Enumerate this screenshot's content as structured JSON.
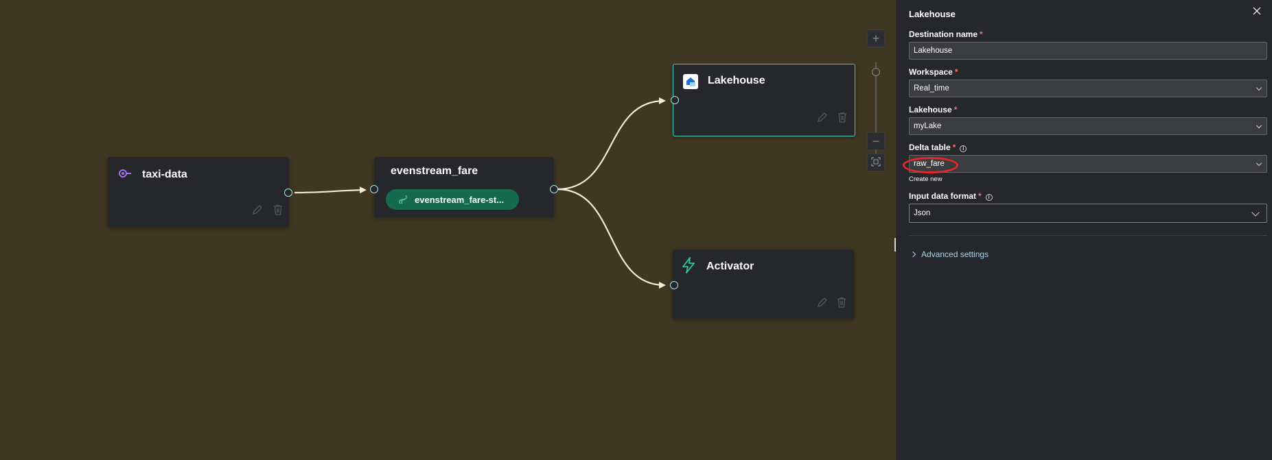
{
  "canvas": {
    "nodes": {
      "source": {
        "title": "taxi-data",
        "icon": "custom-endpoint-icon"
      },
      "stream": {
        "title": "evenstream_fare",
        "chip_label": "evenstream_fare-st..."
      },
      "lakehouse": {
        "title": "Lakehouse",
        "icon": "lakehouse-icon"
      },
      "activator": {
        "title": "Activator",
        "icon": "lightning-icon"
      }
    },
    "zoom_controls": {
      "zoom_in": "+",
      "zoom_out": "−",
      "fit": "fit-to-screen-icon"
    }
  },
  "panel": {
    "title": "Lakehouse",
    "fields": {
      "destination_name": {
        "label": "Destination name",
        "value": "Lakehouse"
      },
      "workspace": {
        "label": "Workspace",
        "value": "Real_time"
      },
      "lakehouse": {
        "label": "Lakehouse",
        "value": "myLake"
      },
      "delta_table": {
        "label": "Delta table",
        "value": "raw_fare",
        "create_new": "Create new"
      },
      "input_format": {
        "label": "Input data format",
        "value": "Json"
      }
    },
    "required_mark": "*",
    "advanced_settings": "Advanced settings"
  },
  "colors": {
    "canvas_bg": "#3f3721",
    "node_bg": "#25272a",
    "selected_border": "#3fd6c0",
    "chip_bg": "#166a4e",
    "annotation": "#e8272d"
  }
}
